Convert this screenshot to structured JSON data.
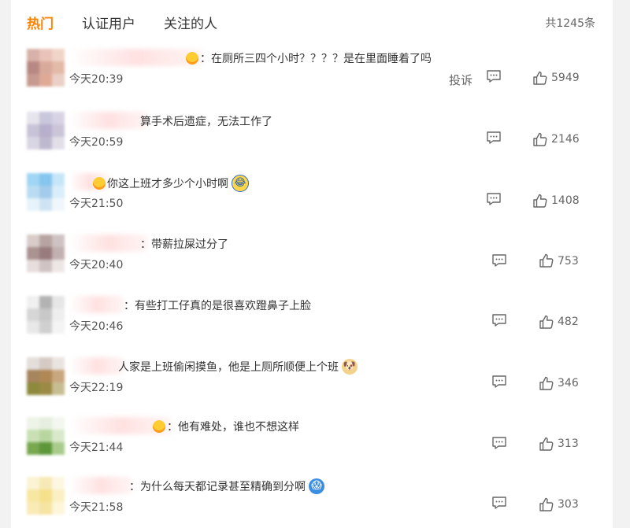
{
  "tabs": [
    {
      "label": "热门",
      "active": true
    },
    {
      "label": "认证用户",
      "active": false
    },
    {
      "label": "关注的人",
      "active": false
    }
  ],
  "total_count": "共1245条",
  "report_label": "投诉",
  "colors": {
    "accent": "#ff8200",
    "text": "#333333",
    "muted": "#666666"
  },
  "comments": [
    {
      "text": "：在厕所三四个小时？？？？是在里面睡着了吗",
      "time": "今天20:39",
      "likes": "5949",
      "badge": true,
      "emoji": "",
      "show_report": true,
      "avatar": [
        "#d8b2a9",
        "#e9c3b8",
        "#f0d4c8",
        "#b88882",
        "#d7aa9c",
        "#e3b9a8",
        "#c79a90",
        "#dfa996",
        "#ead0c6"
      ]
    },
    {
      "text": "算手术后遗症，无法工作了",
      "time": "今天20:59",
      "likes": "2146",
      "badge": false,
      "emoji": "",
      "show_report": false,
      "avatar": [
        "#e6e4ec",
        "#c9c7dc",
        "#d7d3e4",
        "#c8c3d6",
        "#b7afcb",
        "#cbc5d8",
        "#d9d6e3",
        "#bfb9cf",
        "#e2dfe9"
      ]
    },
    {
      "text": "你这上班才多少个小时啊",
      "time": "今天21:50",
      "likes": "1408",
      "badge": true,
      "emoji": "laugh",
      "show_report": false,
      "avatar": [
        "#9fd6f3",
        "#86c6ee",
        "#c6e6f8",
        "#b9dcf2",
        "#a3cbea",
        "#d9eefa",
        "#e7f3fb",
        "#cfe3f3",
        "#f0f7fc"
      ]
    },
    {
      "text": "：带薪拉屎过分了",
      "time": "今天20:40",
      "likes": "753",
      "badge": false,
      "emoji": "",
      "show_report": false,
      "avatar": [
        "#d9ccc9",
        "#b7a4a2",
        "#cfc2c2",
        "#ab9392",
        "#987c7d",
        "#c2b1b1",
        "#e6dddc",
        "#d0c3c3",
        "#ede6e5"
      ]
    },
    {
      "text": "：有些打工仔真的是很喜欢蹬鼻子上脸",
      "time": "今天20:46",
      "likes": "482",
      "badge": false,
      "emoji": "",
      "show_report": false,
      "avatar": [
        "#f0f0f0",
        "#b3b3b3",
        "#e6e6e6",
        "#d6d6d6",
        "#c8c8c8",
        "#eeeeee",
        "#e8e8e8",
        "#d0d0d0",
        "#f4f4f4"
      ]
    },
    {
      "text": "人家是上班偷闲摸鱼，他是上厕所顺便上个班",
      "time": "今天22:19",
      "likes": "346",
      "badge": false,
      "emoji": "doge",
      "show_report": false,
      "avatar": [
        "#e4dedb",
        "#d5cac4",
        "#eae4e0",
        "#a7855e",
        "#b08856",
        "#c9a77e",
        "#8d8a3d",
        "#9a8a45",
        "#c8bd92"
      ]
    },
    {
      "text": "：他有难处，谁也不想这样",
      "time": "今天21:44",
      "likes": "313",
      "badge": true,
      "emoji": "",
      "show_report": false,
      "avatar": [
        "#eef4e8",
        "#e6efdf",
        "#f3f7ef",
        "#c8e0b4",
        "#b9d6a0",
        "#d9e9cb",
        "#78a84f",
        "#5e963a",
        "#a9cc8c"
      ]
    },
    {
      "text": "：为什么每天都记录甚至精确到分啊",
      "time": "今天21:58",
      "likes": "303",
      "badge": false,
      "emoji": "dora",
      "show_report": false,
      "avatar": [
        "#fbf3d4",
        "#f7e9b6",
        "#fdf7e2",
        "#f8e7a3",
        "#f5e08c",
        "#fbefc4",
        "#f9eab6",
        "#f6e4a2",
        "#fdf6da"
      ]
    }
  ]
}
